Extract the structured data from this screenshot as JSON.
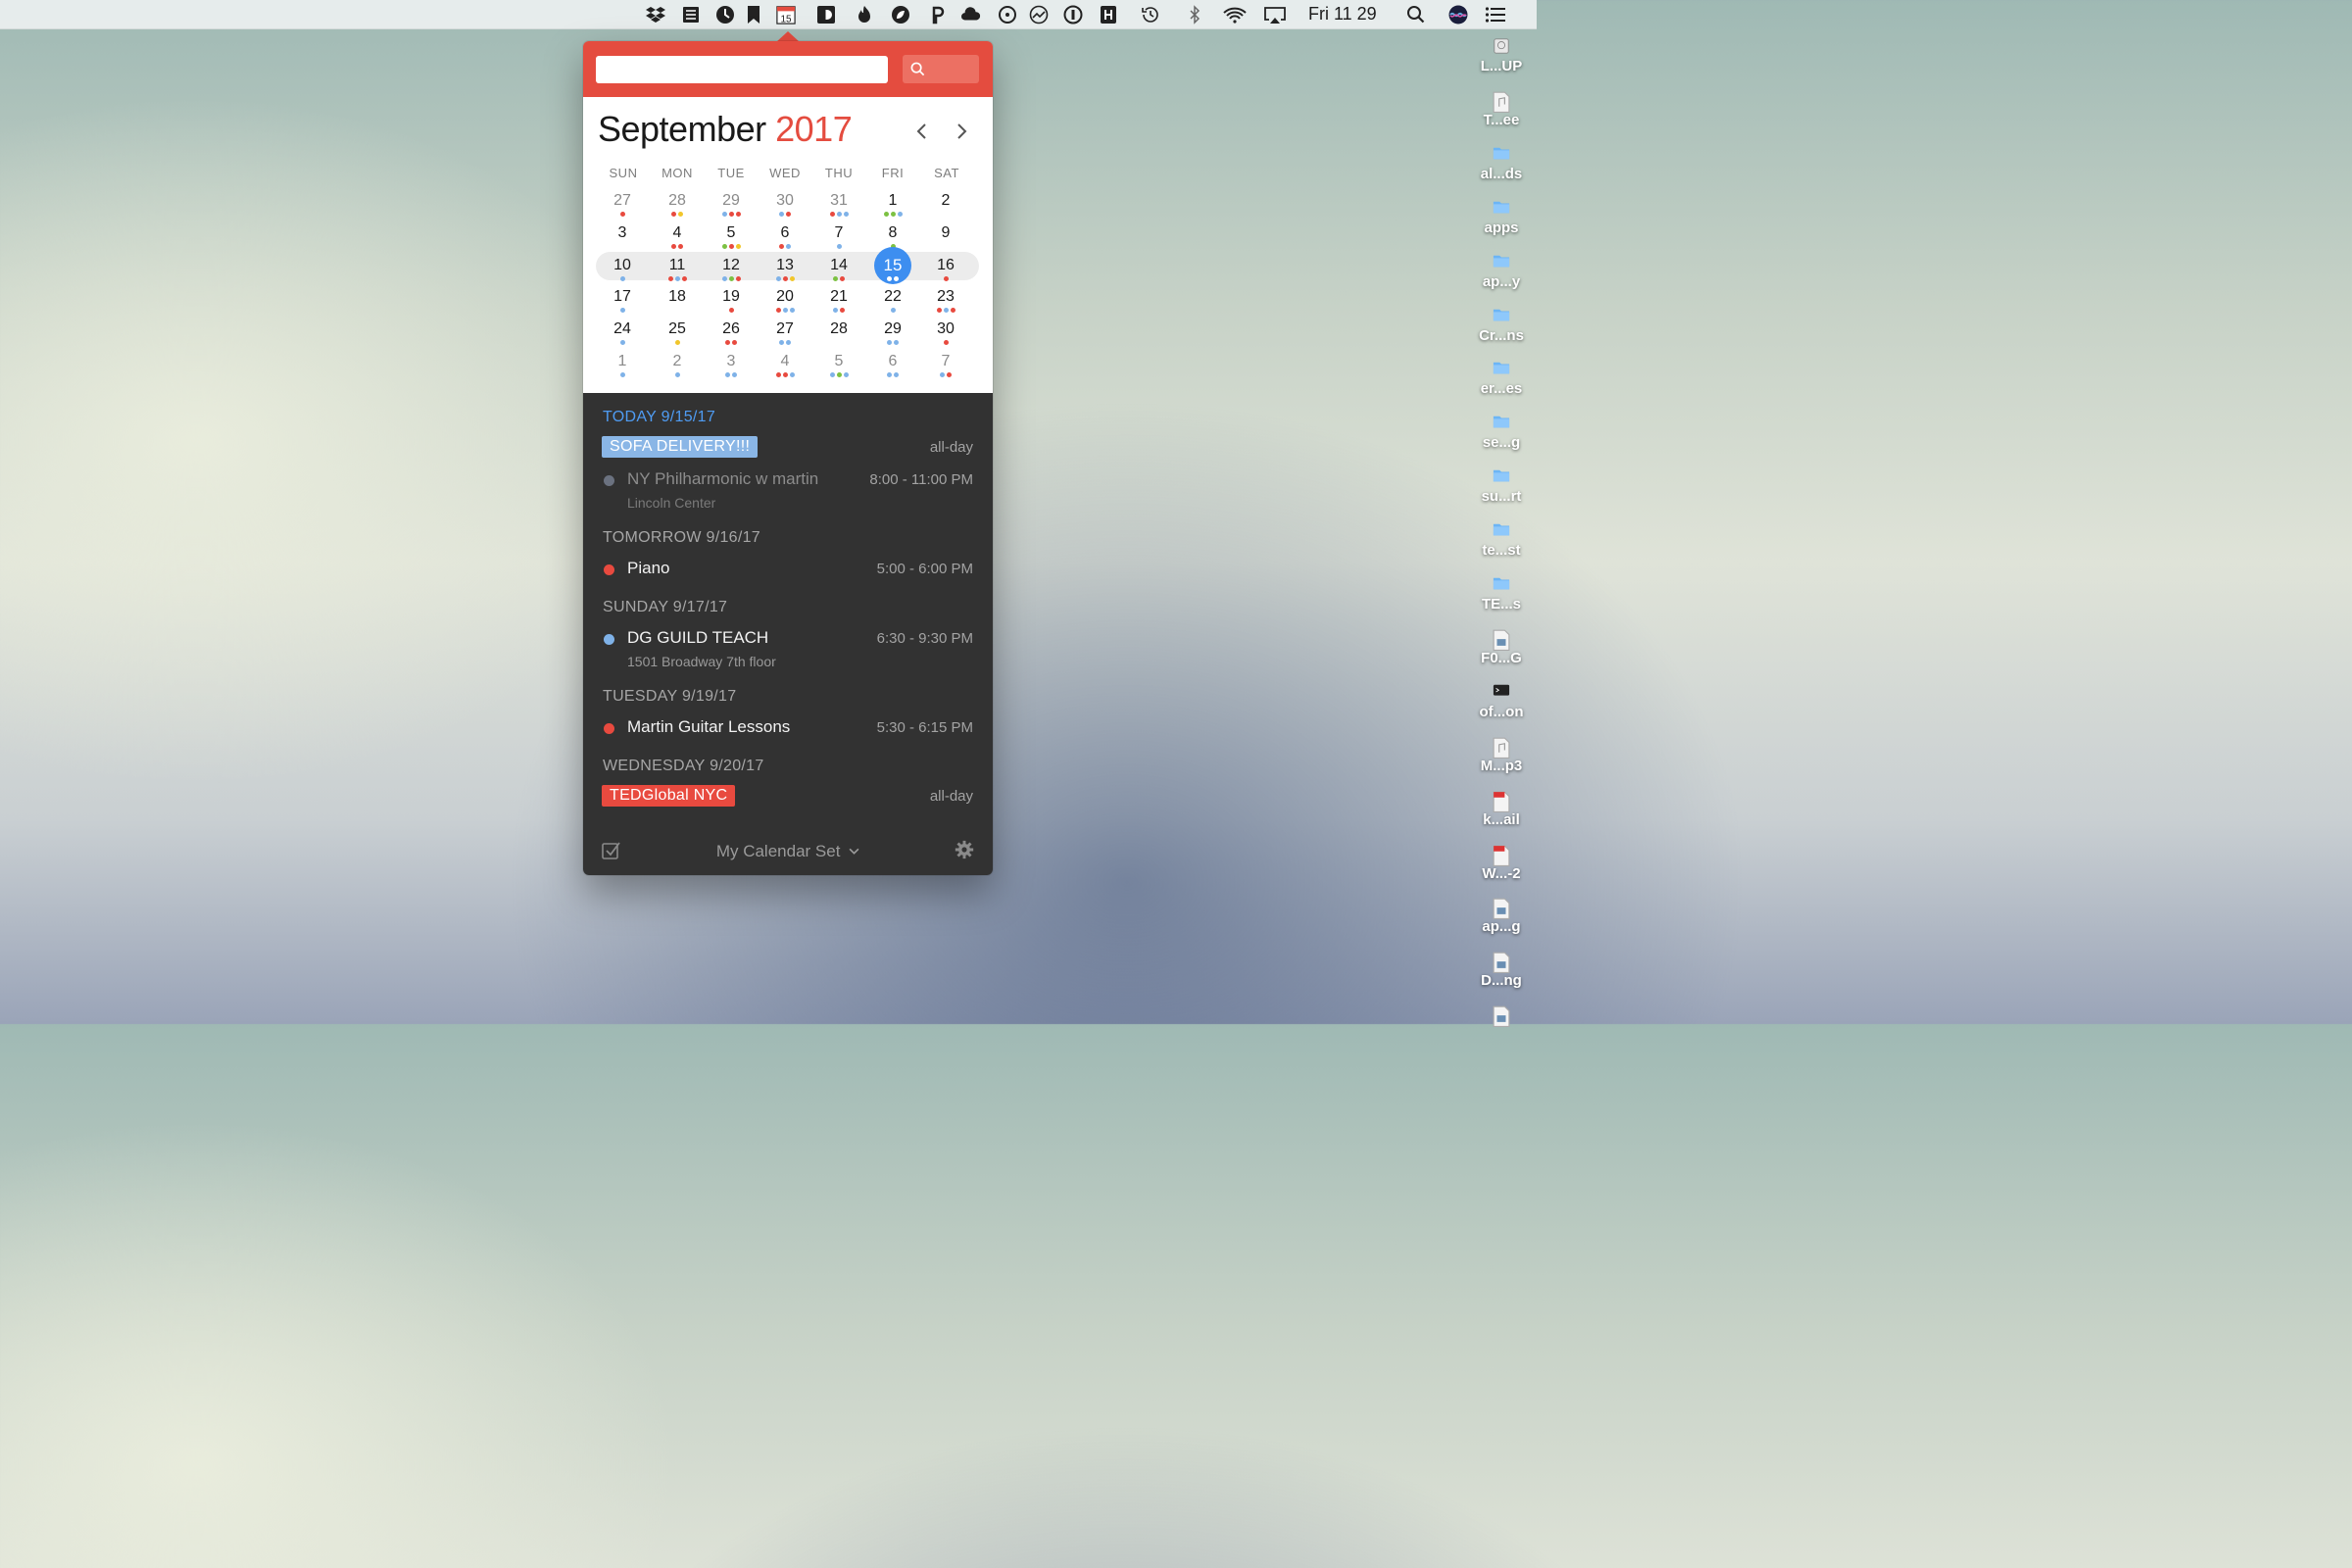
{
  "menubar": {
    "clock": "Fri 11 29",
    "calendar_icon_day": "15",
    "icons": [
      "dropbox-icon",
      "stack-icon",
      "clock-app-icon",
      "bookmark-icon",
      "calendar-icon",
      "docker-icon",
      "fire-icon",
      "leaf-icon",
      "p-app-icon",
      "cloud-icon",
      "timer-icon",
      "gauge-icon",
      "onepassword-icon",
      "h-app-icon",
      "time-machine-icon",
      "bluetooth-icon",
      "wifi-icon",
      "airplay-icon",
      "spotlight-icon",
      "siri-icon",
      "notification-center-icon"
    ]
  },
  "search": {
    "placeholder": "",
    "value": ""
  },
  "calendar": {
    "month": "September",
    "year": "2017",
    "weekdays": [
      "SUN",
      "MON",
      "TUE",
      "WED",
      "THU",
      "FRI",
      "SAT"
    ],
    "weeks": [
      [
        {
          "d": "27",
          "o": true,
          "dots": [
            "r"
          ]
        },
        {
          "d": "28",
          "o": true,
          "dots": [
            "r",
            "y"
          ]
        },
        {
          "d": "29",
          "o": true,
          "dots": [
            "b",
            "r",
            "r"
          ]
        },
        {
          "d": "30",
          "o": true,
          "dots": [
            "b",
            "r"
          ]
        },
        {
          "d": "31",
          "o": true,
          "dots": [
            "r",
            "b",
            "b"
          ]
        },
        {
          "d": "1",
          "dots": [
            "g",
            "g",
            "b"
          ]
        },
        {
          "d": "2",
          "dots": []
        }
      ],
      [
        {
          "d": "3",
          "dots": []
        },
        {
          "d": "4",
          "dots": [
            "r",
            "r"
          ]
        },
        {
          "d": "5",
          "dots": [
            "g",
            "r",
            "y"
          ]
        },
        {
          "d": "6",
          "dots": [
            "r",
            "b"
          ]
        },
        {
          "d": "7",
          "dots": [
            "b"
          ]
        },
        {
          "d": "8",
          "dots": [
            "g"
          ]
        },
        {
          "d": "9",
          "dots": []
        }
      ],
      [
        {
          "d": "10",
          "dots": [
            "b"
          ]
        },
        {
          "d": "11",
          "dots": [
            "r",
            "b",
            "r"
          ]
        },
        {
          "d": "12",
          "dots": [
            "b",
            "g",
            "r"
          ]
        },
        {
          "d": "13",
          "dots": [
            "b",
            "r",
            "y"
          ]
        },
        {
          "d": "14",
          "dots": [
            "g",
            "r"
          ]
        },
        {
          "d": "15",
          "today": true,
          "dots": [
            "w",
            "w"
          ]
        },
        {
          "d": "16",
          "dots": [
            "r"
          ]
        }
      ],
      [
        {
          "d": "17",
          "dots": [
            "b"
          ]
        },
        {
          "d": "18",
          "dots": []
        },
        {
          "d": "19",
          "dots": [
            "r"
          ]
        },
        {
          "d": "20",
          "dots": [
            "r",
            "b",
            "b"
          ]
        },
        {
          "d": "21",
          "dots": [
            "b",
            "r"
          ]
        },
        {
          "d": "22",
          "dots": [
            "b"
          ]
        },
        {
          "d": "23",
          "dots": [
            "r",
            "b",
            "r"
          ]
        }
      ],
      [
        {
          "d": "24",
          "dots": [
            "b"
          ]
        },
        {
          "d": "25",
          "dots": [
            "y"
          ]
        },
        {
          "d": "26",
          "dots": [
            "r",
            "r"
          ]
        },
        {
          "d": "27",
          "dots": [
            "b",
            "b"
          ]
        },
        {
          "d": "28",
          "dots": []
        },
        {
          "d": "29",
          "dots": [
            "b",
            "b"
          ]
        },
        {
          "d": "30",
          "dots": [
            "r"
          ]
        }
      ],
      [
        {
          "d": "1",
          "o": true,
          "dots": [
            "b"
          ]
        },
        {
          "d": "2",
          "o": true,
          "dots": [
            "b"
          ]
        },
        {
          "d": "3",
          "o": true,
          "dots": [
            "b",
            "b"
          ]
        },
        {
          "d": "4",
          "o": true,
          "dots": [
            "r",
            "r",
            "b"
          ]
        },
        {
          "d": "5",
          "o": true,
          "dots": [
            "b",
            "g",
            "b"
          ]
        },
        {
          "d": "6",
          "o": true,
          "dots": [
            "b",
            "b"
          ]
        },
        {
          "d": "7",
          "o": true,
          "dots": [
            "b",
            "r"
          ]
        }
      ]
    ]
  },
  "colors": {
    "accent_red": "#e44c3f",
    "today_blue": "#3d8ef0",
    "r": "#e84a3f",
    "b": "#7fb2e8",
    "g": "#7cc142",
    "y": "#f1c62b",
    "w": "#ffffff",
    "pill_blue": "#8ab6e6",
    "dot_gray": "#6b7280"
  },
  "events": {
    "groups": [
      {
        "header": "TODAY 9/15/17",
        "items": [
          {
            "kind": "pill",
            "title": "SOFA DELIVERY!!!",
            "time": "all-day",
            "color": "pill_blue"
          },
          {
            "kind": "dot",
            "title": "NY Philharmonic w martin",
            "location": "Lincoln Center",
            "time": "8:00 - 11:00 PM",
            "color": "dot_gray",
            "past": true
          }
        ]
      },
      {
        "header": "TOMORROW 9/16/17",
        "items": [
          {
            "kind": "dot",
            "title": "Piano",
            "time": "5:00 - 6:00 PM",
            "color": "r"
          }
        ]
      },
      {
        "header": "SUNDAY 9/17/17",
        "items": [
          {
            "kind": "dot",
            "title": "DG GUILD TEACH",
            "location": "1501 Broadway 7th floor",
            "time": "6:30 - 9:30 PM",
            "color": "b"
          }
        ]
      },
      {
        "header": "TUESDAY 9/19/17",
        "items": [
          {
            "kind": "dot",
            "title": "Martin Guitar Lessons",
            "time": "5:30 - 6:15 PM",
            "color": "r"
          }
        ]
      },
      {
        "header": "WEDNESDAY 9/20/17",
        "items": [
          {
            "kind": "pill",
            "title": "TEDGlobal NYC",
            "time": "all-day",
            "color": "r"
          }
        ]
      }
    ]
  },
  "footer": {
    "calendar_set": "My Calendar Set"
  },
  "desktop": {
    "items": [
      {
        "label": "L...UP",
        "icon": "disk-icon"
      },
      {
        "label": "T...ee",
        "icon": "audio-file-icon"
      },
      {
        "label": "al...ds",
        "icon": "folder-icon"
      },
      {
        "label": "apps",
        "icon": "folder-icon"
      },
      {
        "label": "ap...y",
        "icon": "folder-icon"
      },
      {
        "label": "Cr...ns",
        "icon": "folder-icon"
      },
      {
        "label": "er...es",
        "icon": "folder-icon"
      },
      {
        "label": "se...g",
        "icon": "folder-icon"
      },
      {
        "label": "su...rt",
        "icon": "folder-icon"
      },
      {
        "label": "te...st",
        "icon": "folder-icon"
      },
      {
        "label": "TE...s",
        "icon": "folder-icon"
      },
      {
        "label": "F0...G",
        "icon": "image-file-icon"
      },
      {
        "label": "of...on",
        "icon": "terminal-icon"
      },
      {
        "label": "M...p3",
        "icon": "audio-file-icon"
      },
      {
        "label": "k...ail",
        "icon": "pdf-file-icon"
      },
      {
        "label": "W...-2",
        "icon": "pdf-file-icon"
      },
      {
        "label": "ap...g",
        "icon": "image-file-icon"
      },
      {
        "label": "D...ng",
        "icon": "image-file-icon"
      },
      {
        "label": "",
        "icon": "image-file-icon"
      }
    ]
  }
}
